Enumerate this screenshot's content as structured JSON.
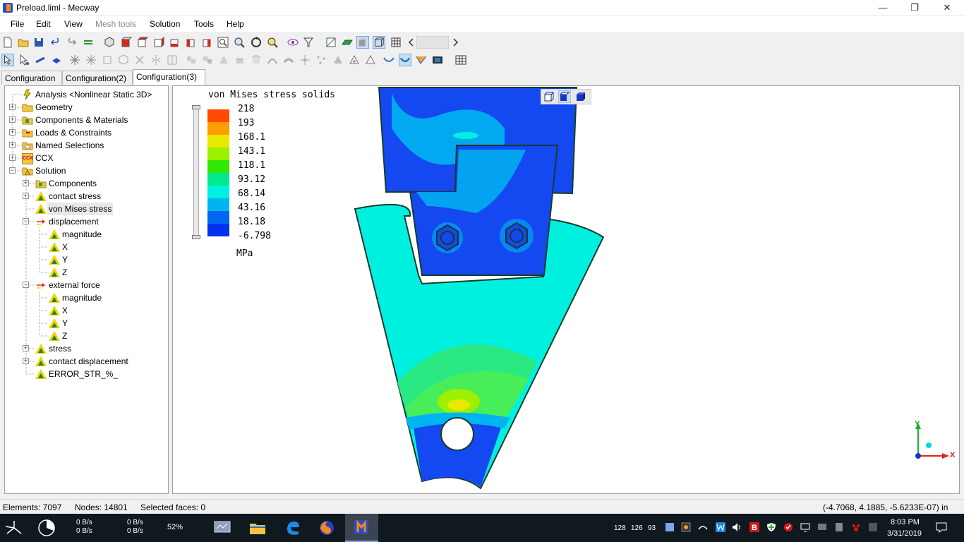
{
  "window": {
    "title": "Preload.liml - Mecway",
    "minimize": "—",
    "restore": "❐",
    "close": "✕"
  },
  "menu": [
    "File",
    "Edit",
    "View",
    "Mesh tools",
    "Solution",
    "Tools",
    "Help"
  ],
  "menu_disabled_index": 3,
  "tabs": [
    "Configuration",
    "Configuration(2)",
    "Configuration(3)"
  ],
  "active_tab": 2,
  "tree": {
    "analysis": "Analysis <Nonlinear Static 3D>",
    "geometry": "Geometry",
    "components_materials": "Components & Materials",
    "loads": "Loads & Constraints",
    "named_selections": "Named Selections",
    "ccx": "CCX",
    "ccx_icon_text": "CCX",
    "solution": "Solution",
    "components": "Components",
    "contact_stress": "contact stress",
    "von_mises": "von Mises stress",
    "displacement": "displacement",
    "disp_magnitude": "magnitude",
    "disp_x": "X",
    "disp_y": "Y",
    "disp_z": "Z",
    "external_force": "external force",
    "ef_magnitude": "magnitude",
    "ef_x": "X",
    "ef_y": "Y",
    "ef_z": "Z",
    "stress": "stress",
    "contact_displacement": "contact displacement",
    "error": "ERROR_STR_%_"
  },
  "legend": {
    "title": "von Mises stress solids",
    "values": [
      "218",
      "193",
      "168.1",
      "143.1",
      "118.1",
      "93.12",
      "68.14",
      "43.16",
      "18.18",
      "-6.798"
    ],
    "colors": [
      "#ff4a00",
      "#ff9c00",
      "#e8e800",
      "#9cf000",
      "#30e800",
      "#00e890",
      "#00f0e0",
      "#00b4f0",
      "#0068f0",
      "#0030f0"
    ],
    "unit": "MPa"
  },
  "axes": {
    "x": "X",
    "y": "Y"
  },
  "status": {
    "elements": "Elements: 7097",
    "nodes": "Nodes: 14801",
    "selected": "Selected faces: 0",
    "coords": "(-4.7068, 4.1885, -5.6233E-07) in"
  },
  "taskbar": {
    "net1_up": "0 B/s",
    "net1_down": "0 B/s",
    "net2_up": "0 B/s",
    "net2_down": "0 B/s",
    "cpu": "52%",
    "tray_nums": [
      "128",
      "126",
      "93"
    ],
    "time": "8:03 PM",
    "date": "3/31/2019"
  },
  "colors": {
    "accent": "#0068f0",
    "model_base": "#00f0e0",
    "model_blue": "#1448f0"
  }
}
